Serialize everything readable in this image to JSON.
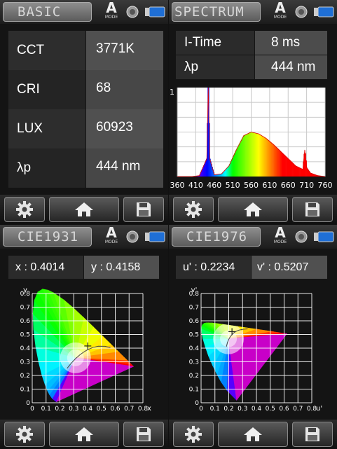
{
  "basic": {
    "title": "BASIC",
    "mode": {
      "letter": "A",
      "label": "MODE"
    },
    "rows": [
      {
        "label": "CCT",
        "value": "3771K"
      },
      {
        "label": "CRI",
        "value": "68"
      },
      {
        "label": "LUX",
        "value": "60923"
      },
      {
        "label": "λp",
        "value": "444 nm"
      }
    ]
  },
  "spectrum": {
    "title": "SPECTRUM",
    "mode": {
      "letter": "A",
      "label": "MODE"
    },
    "rows": [
      {
        "label": "I-Time",
        "value": "8 ms"
      },
      {
        "label": "λp",
        "value": "444 nm"
      }
    ]
  },
  "cie1931": {
    "title": "CIE1931",
    "mode": {
      "letter": "A",
      "label": "MODE"
    },
    "x_label": "x",
    "x_value": ": 0.4014",
    "y_label": "y",
    "y_value": ": 0.4158",
    "axis_x": "x",
    "axis_y": "y"
  },
  "cie1976": {
    "title": "CIE1976",
    "mode": {
      "letter": "A",
      "label": "MODE"
    },
    "u_label": "u'",
    "u_value": ": 0.2234",
    "v_label": "v'",
    "v_value": ": 0.5207",
    "axis_x": "u'",
    "axis_y": "v'"
  },
  "icons": [
    "gear-icon",
    "home-icon",
    "save-icon",
    "knob-icon",
    "battery-icon"
  ],
  "chart_data": [
    {
      "type": "line",
      "x": [
        360,
        400,
        420,
        440,
        444,
        448,
        460,
        480,
        500,
        520,
        540,
        560,
        580,
        600,
        620,
        640,
        660,
        680,
        700,
        705,
        710,
        720,
        740,
        760
      ],
      "y": [
        0,
        0,
        0.01,
        0.2,
        1.0,
        0.2,
        0.02,
        0.03,
        0.12,
        0.3,
        0.46,
        0.5,
        0.48,
        0.43,
        0.36,
        0.28,
        0.2,
        0.12,
        0.08,
        0.3,
        0.1,
        0.04,
        0.01,
        0
      ],
      "xticks": [
        "360",
        "410",
        "460",
        "510",
        "560",
        "610",
        "660",
        "710",
        "760"
      ],
      "ylim": [
        0,
        1
      ],
      "ytick_label": "1",
      "grid": true
    },
    {
      "type": "scatter",
      "xticks": [
        "0",
        "0.1",
        "0.2",
        "0.3",
        "0.4",
        "0.5",
        "0.6",
        "0.7",
        "0.8"
      ],
      "yticks": [
        "0",
        "0.1",
        "0.2",
        "0.3",
        "0.4",
        "0.5",
        "0.6",
        "0.7",
        "0.8"
      ],
      "xlim": [
        0,
        0.8
      ],
      "ylim": [
        0,
        0.8
      ],
      "point": {
        "x": 0.4014,
        "y": 0.4158
      },
      "grid": true
    },
    {
      "type": "scatter",
      "xticks": [
        "0",
        "0.1",
        "0.2",
        "0.3",
        "0.4",
        "0.5",
        "0.6",
        "0.7",
        "0.8"
      ],
      "yticks": [
        "0",
        "0.1",
        "0.2",
        "0.3",
        "0.4",
        "0.5",
        "0.6",
        "0.7",
        "0.8"
      ],
      "xlim": [
        0,
        0.8
      ],
      "ylim": [
        0,
        0.8
      ],
      "point": {
        "x": 0.2234,
        "y": 0.5207
      },
      "grid": true
    }
  ]
}
